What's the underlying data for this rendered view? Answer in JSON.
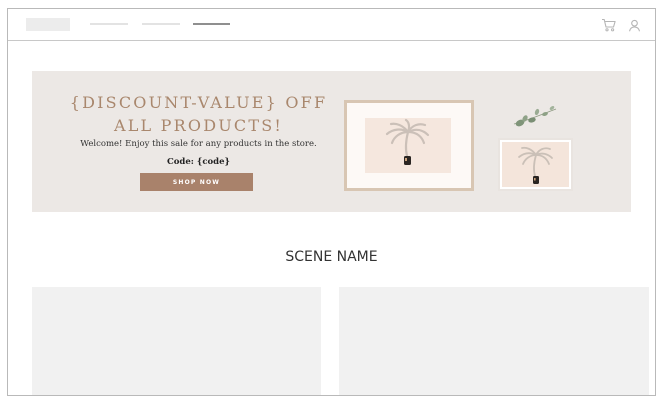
{
  "header": {
    "icons": [
      "cart-icon",
      "user-icon"
    ]
  },
  "hero": {
    "headline_line1": "{DISCOUNT-VALUE} OFF",
    "headline_line2": "ALL PRODUCTS!",
    "subtext": "Welcome! Enjoy this sale for any products in the store.",
    "code_text": "Code: {code}",
    "cta_label": "SHOP NOW"
  },
  "scene": {
    "title": "SCENE NAME"
  },
  "colors": {
    "accent": "#a9826b",
    "headline": "#a9876d",
    "banner_bg": "#ece8e5",
    "card_bg": "#f1f1f1"
  }
}
